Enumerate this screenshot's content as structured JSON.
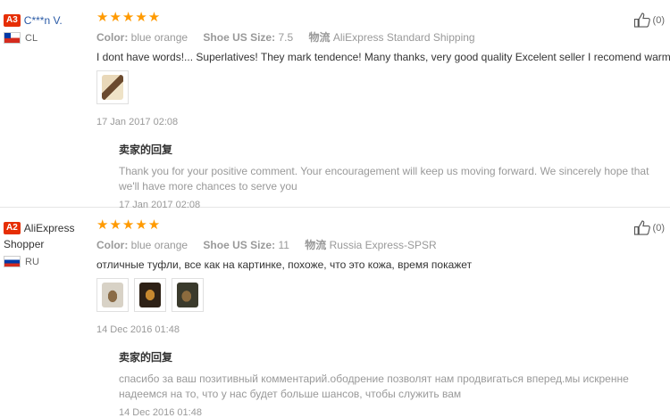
{
  "reviews": [
    {
      "level": "A3",
      "name": "C***n V.",
      "country": "CL",
      "stars": "★★★★★",
      "color_label": "Color:",
      "color": "blue orange",
      "size_label": "Shoe US Size:",
      "size": "7.5",
      "ship_label": "物流",
      "shipping": "AliExpress Standard Shipping",
      "text": "I dont have words!... Superlatives! They mark tendence! Many thanks, very good quality Excelent seller I recomend warmly!",
      "date": "17 Jan 2017 02:08",
      "reply_title": "卖家的回复",
      "reply": "Thank you for your positive comment. Your encouragement will keep us moving forward. We sincerely hope that we'll have more chances to serve you",
      "reply_date": "17 Jan 2017 02:08",
      "likes": "(0)"
    },
    {
      "level": "A2",
      "name": "AliExpress Shopper",
      "country": "RU",
      "stars": "★★★★★",
      "color_label": "Color:",
      "color": "blue orange",
      "size_label": "Shoe US Size:",
      "size": "11",
      "ship_label": "物流",
      "shipping": "Russia Express-SPSR",
      "text": "отличные туфли, все как на картинке, похоже, что это кожа, время покажет",
      "date": "14 Dec 2016 01:48",
      "reply_title": "卖家的回复",
      "reply": "спасибо за ваш позитивный комментарий.ободрение позволят нам продвигаться вперед.мы искренне надеемся на то, что у нас будет больше шансов, чтобы служить вам",
      "reply_date": "14 Dec 2016 01:48",
      "likes": "(0)"
    }
  ],
  "colors": {
    "badge": "#e62e04",
    "stars": "#ff9a00",
    "username": "#2a5aa6"
  },
  "icons": {
    "like": "thumbs-up-icon"
  }
}
